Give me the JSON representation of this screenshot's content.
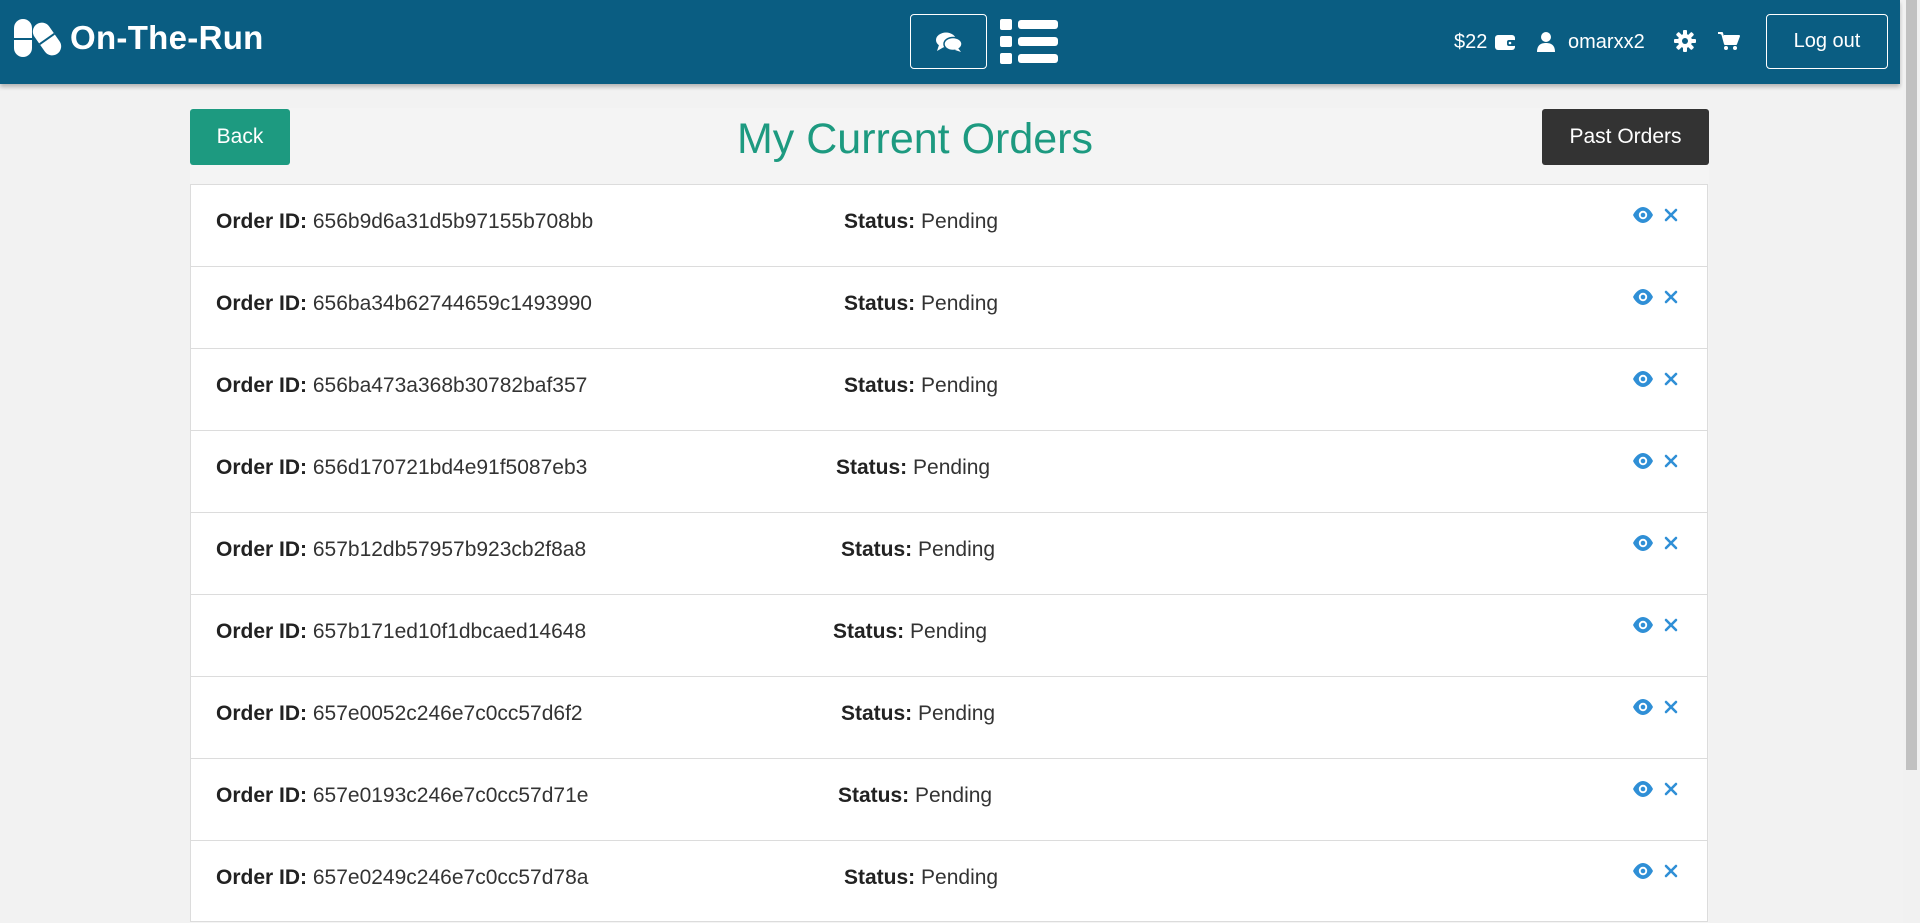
{
  "header": {
    "brand": "On-The-Run",
    "balance": "$22",
    "username": "omarxx2",
    "logout_label": "Log out",
    "icons": [
      "pills-icon",
      "chat-icon",
      "list-icon",
      "wallet-icon",
      "user-icon",
      "gear-icon",
      "cart-icon"
    ]
  },
  "page": {
    "back_label": "Back",
    "title": "My Current Orders",
    "past_orders_label": "Past Orders"
  },
  "labels": {
    "order_id": "Order ID:",
    "status": "Status:"
  },
  "orders": [
    {
      "id": "656b9d6a31d5b97155b708bb",
      "status": "Pending"
    },
    {
      "id": "656ba34b62744659c1493990",
      "status": "Pending"
    },
    {
      "id": "656ba473a368b30782baf357",
      "status": "Pending"
    },
    {
      "id": "656d170721bd4e91f5087eb3",
      "status": "Pending"
    },
    {
      "id": "657b12db57957b923cb2f8a8",
      "status": "Pending"
    },
    {
      "id": "657b171ed10f1dbcaed14648",
      "status": "Pending"
    },
    {
      "id": "657e0052c246e7c0cc57d6f2",
      "status": "Pending"
    },
    {
      "id": "657e0193c246e7c0cc57d71e",
      "status": "Pending"
    },
    {
      "id": "657e0249c246e7c0cc57d78a",
      "status": "Pending"
    }
  ],
  "colors": {
    "navbar": "#0a5d82",
    "accent": "#1d9a80",
    "dark_button": "#333333",
    "action_icon": "#2f8fd6"
  }
}
